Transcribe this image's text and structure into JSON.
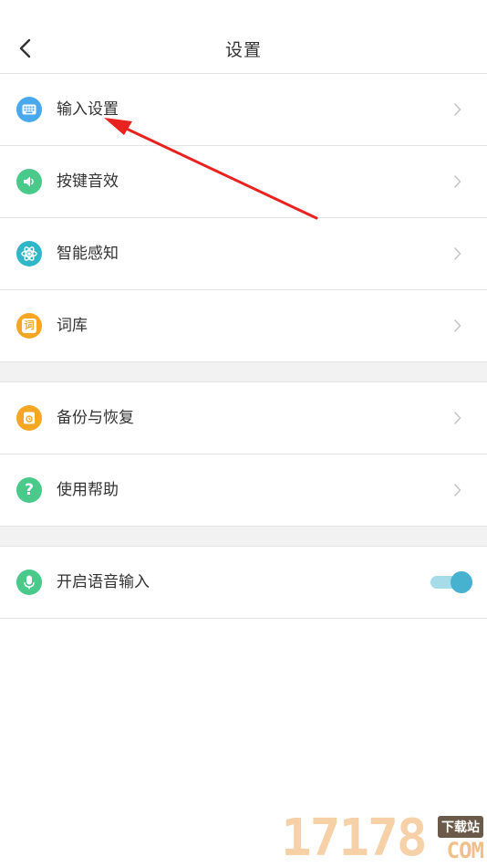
{
  "header": {
    "title": "设置"
  },
  "rows": [
    {
      "label": "输入设置",
      "icon": "keyboard-icon",
      "color": "#4aa8ee"
    },
    {
      "label": "按键音效",
      "icon": "speaker-icon",
      "color": "#49c98a"
    },
    {
      "label": "智能感知",
      "icon": "atom-icon",
      "color": "#2fb7c8"
    },
    {
      "label": "词库",
      "icon": "dictionary-icon",
      "icon_text": "词",
      "color": "#f6a623"
    },
    {
      "label": "备份与恢复",
      "icon": "backup-icon",
      "color": "#f6a623"
    },
    {
      "label": "使用帮助",
      "icon": "help-icon",
      "icon_text": "?",
      "color": "#49c98a"
    },
    {
      "label": "开启语音输入",
      "icon": "microphone-icon",
      "color": "#49c98a"
    }
  ],
  "voice_toggle": {
    "on": true
  },
  "colors": {
    "accent": "#46b2d0",
    "arrow": "#e8231f",
    "divider": "#e3e3e3",
    "section_gap": "#f2f2f2"
  },
  "watermark": {
    "number": "17178",
    "badge": "下载站",
    "domain": "COM"
  }
}
